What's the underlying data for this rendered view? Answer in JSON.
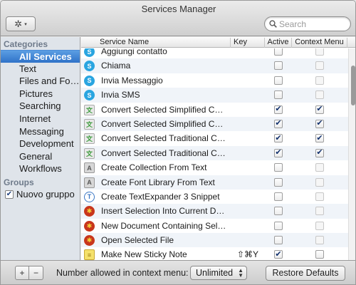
{
  "window": {
    "title": "Services Manager"
  },
  "toolbar": {
    "gear_icon": "gear-icon",
    "gear_arrow": "▾"
  },
  "search": {
    "placeholder": "Search",
    "value": ""
  },
  "sidebar": {
    "categories_label": "Categories",
    "items": [
      {
        "label": "All Services",
        "selected": true
      },
      {
        "label": "Text"
      },
      {
        "label": "Files and Fo…"
      },
      {
        "label": "Pictures"
      },
      {
        "label": "Searching"
      },
      {
        "label": "Internet"
      },
      {
        "label": "Messaging"
      },
      {
        "label": "Development"
      },
      {
        "label": "General"
      },
      {
        "label": "Workflows"
      }
    ],
    "groups_label": "Groups",
    "groups": [
      {
        "label": "Nuovo gruppo",
        "checked": true
      }
    ]
  },
  "table": {
    "columns": {
      "name": "Service Name",
      "key": "Key",
      "active": "Active",
      "context": "Context Menu"
    },
    "rows": [
      {
        "icon": "skype",
        "name": "Aggiungi contatto",
        "key": "",
        "active": false,
        "context": false
      },
      {
        "icon": "skype",
        "name": "Chiama",
        "key": "",
        "active": false,
        "context": false
      },
      {
        "icon": "skype",
        "name": "Invia Messaggio",
        "key": "",
        "active": false,
        "context": false
      },
      {
        "icon": "skype",
        "name": "Invia SMS",
        "key": "",
        "active": false,
        "context": false
      },
      {
        "icon": "doc",
        "name": "Convert Selected Simplified C…",
        "key": "",
        "active": true,
        "context": true
      },
      {
        "icon": "doc",
        "name": "Convert Selected Simplified C…",
        "key": "",
        "active": true,
        "context": true
      },
      {
        "icon": "doc",
        "name": "Convert Selected Traditional C…",
        "key": "",
        "active": true,
        "context": true
      },
      {
        "icon": "doc",
        "name": "Convert Selected Traditional C…",
        "key": "",
        "active": true,
        "context": true
      },
      {
        "icon": "gray",
        "name": "Create Collection From Text",
        "key": "",
        "active": false,
        "context": false
      },
      {
        "icon": "gray",
        "name": "Create Font Library From Text",
        "key": "",
        "active": false,
        "context": false
      },
      {
        "icon": "te",
        "name": "Create TextExpander 3 Snippet",
        "key": "",
        "active": false,
        "context": false
      },
      {
        "icon": "red",
        "name": "Insert Selection Into Current D…",
        "key": "",
        "active": false,
        "context": false
      },
      {
        "icon": "red",
        "name": "New Document Containing Sel…",
        "key": "",
        "active": false,
        "context": false
      },
      {
        "icon": "red",
        "name": "Open Selected File",
        "key": "",
        "active": false,
        "context": false
      },
      {
        "icon": "sticky",
        "name": "Make New Sticky Note",
        "key": "⇧⌘Y",
        "active": true,
        "context": false
      }
    ]
  },
  "bottom": {
    "plus": "+",
    "minus": "−",
    "context_label": "Number allowed in context menu:",
    "context_value": "Unlimited",
    "restore_label": "Restore Defaults"
  }
}
